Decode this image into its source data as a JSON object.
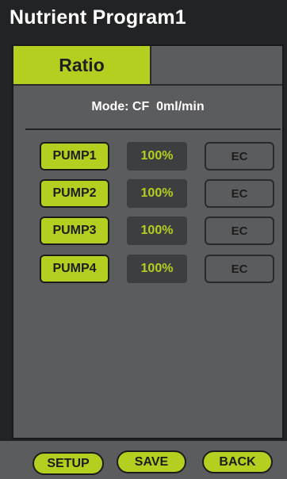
{
  "header": {
    "title": "Nutrient Program1"
  },
  "tabs": {
    "active_label": "Ratio"
  },
  "mode": {
    "text": "Mode: CF  0ml/min"
  },
  "pumps": [
    {
      "label": "PUMP1",
      "percent": "100%",
      "unit": "EC"
    },
    {
      "label": "PUMP2",
      "percent": "100%",
      "unit": "EC"
    },
    {
      "label": "PUMP3",
      "percent": "100%",
      "unit": "EC"
    },
    {
      "label": "PUMP4",
      "percent": "100%",
      "unit": "EC"
    }
  ],
  "footer": {
    "setup_label": "SETUP",
    "save_label": "SAVE",
    "back_label": "BACK"
  },
  "colors": {
    "accent": "#b4cf1f",
    "panel": "#5b5c5d",
    "background": "#222324",
    "value_box": "#3d3e3f"
  }
}
